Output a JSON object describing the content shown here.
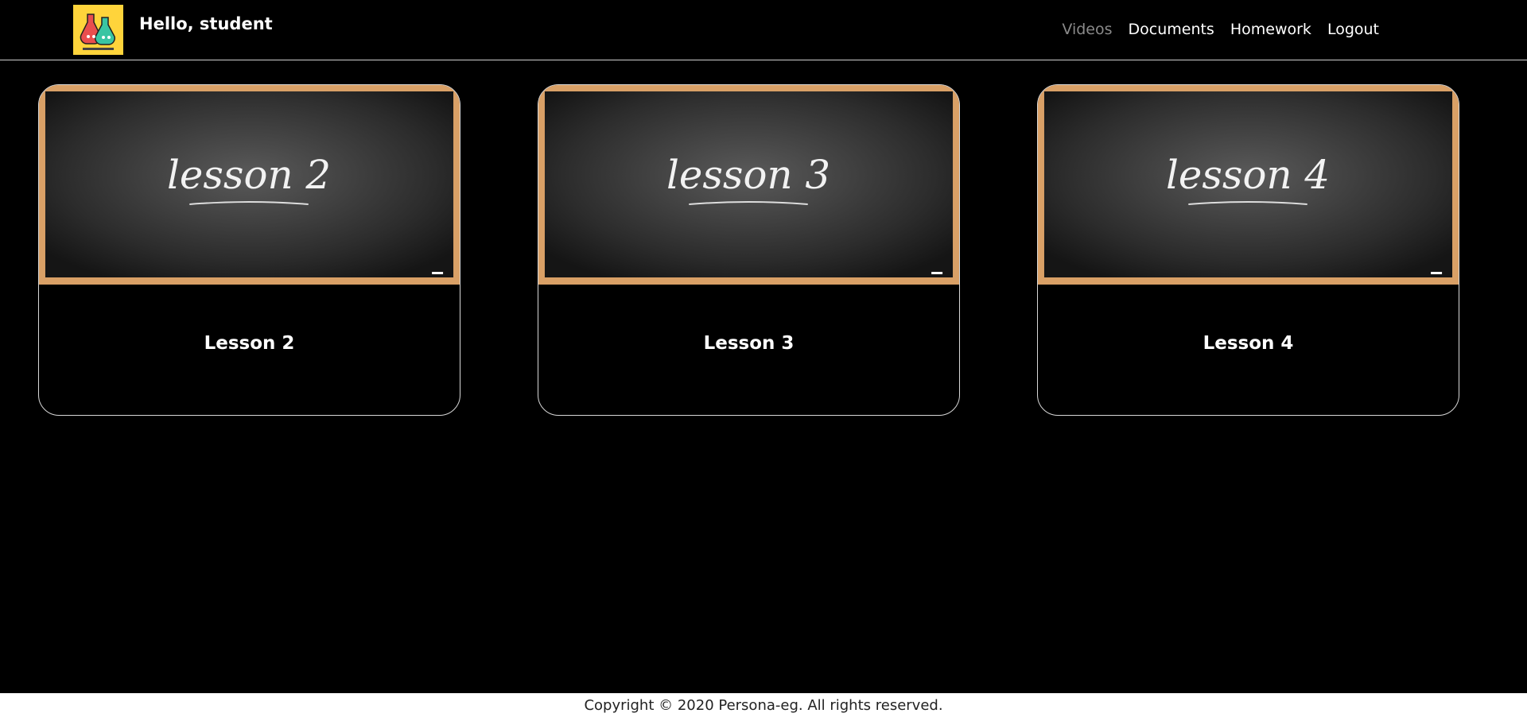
{
  "header": {
    "greeting": "Hello, student",
    "logo_icon": "flask-characters-logo",
    "logo_color": "#ffd43b"
  },
  "nav": {
    "items": [
      {
        "label": "Videos",
        "active": true
      },
      {
        "label": "Documents",
        "active": false
      },
      {
        "label": "Homework",
        "active": false
      },
      {
        "label": "Logout",
        "active": false
      }
    ]
  },
  "lessons": [
    {
      "thumb_text": "lesson 2",
      "title": "Lesson 2"
    },
    {
      "thumb_text": "lesson 3",
      "title": "Lesson 3"
    },
    {
      "thumb_text": "lesson 4",
      "title": "Lesson 4"
    }
  ],
  "footer": {
    "copyright": "Copyright © 2020 Persona-eg. All rights reserved."
  }
}
